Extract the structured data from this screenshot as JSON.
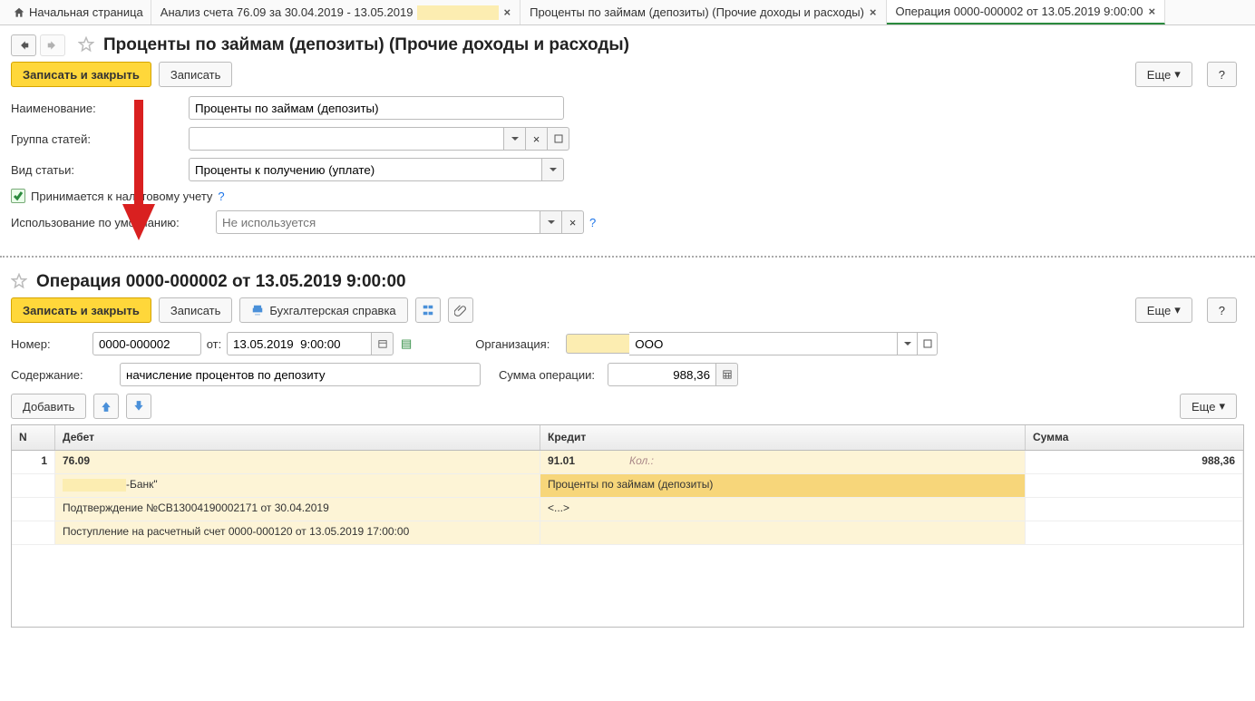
{
  "tabs": {
    "home": "Начальная страница",
    "t1": "Анализ счета 76.09 за 30.04.2019 - 13.05.2019",
    "t2": "Проценты по займам (депозиты) (Прочие доходы и расходы)",
    "t3": "Операция 0000-000002 от 13.05.2019 9:00:00"
  },
  "section1": {
    "title": "Проценты по займам (депозиты) (Прочие доходы и расходы)",
    "buttons": {
      "save_close": "Записать и закрыть",
      "save": "Записать",
      "more": "Еще",
      "help": "?"
    },
    "labels": {
      "name": "Наименование:",
      "group": "Группа статей:",
      "kind": "Вид статьи:",
      "tax": "Принимается к налоговому учету",
      "default_use": "Использование по умолчанию:"
    },
    "values": {
      "name": "Проценты по займам (депозиты)",
      "kind": "Проценты к получению (уплате)",
      "default_use_placeholder": "Не используется"
    }
  },
  "section2": {
    "title": "Операция 0000-000002 от 13.05.2019 9:00:00",
    "buttons": {
      "save_close": "Записать и закрыть",
      "save": "Записать",
      "acc_ref": "Бухгалтерская справка",
      "add": "Добавить",
      "more": "Еще",
      "help": "?"
    },
    "labels": {
      "number": "Номер:",
      "from": "от:",
      "org": "Организация:",
      "content": "Содержание:",
      "opsum": "Сумма операции:"
    },
    "values": {
      "number": "0000-000002",
      "date": "13.05.2019  9:00:00",
      "org": "ООО",
      "content": "начисление процентов по депозиту",
      "opsum": "988,36"
    }
  },
  "grid": {
    "headers": {
      "n": "N",
      "debit": "Дебет",
      "credit": "Кредит",
      "sum": "Сумма"
    },
    "row1": {
      "n": "1",
      "debit": "76.09",
      "credit": "91.01",
      "qty": "Кол.:",
      "sum": "988,36"
    },
    "row2": {
      "debit_suffix": "-Банк\"",
      "credit": "Проценты по займам (депозиты)"
    },
    "row3": {
      "debit": "Подтверждение №СВ13004190002171 от 30.04.2019",
      "credit": "<...>"
    },
    "row4": {
      "debit": "Поступление на расчетный счет 0000-000120 от 13.05.2019 17:00:00"
    }
  }
}
